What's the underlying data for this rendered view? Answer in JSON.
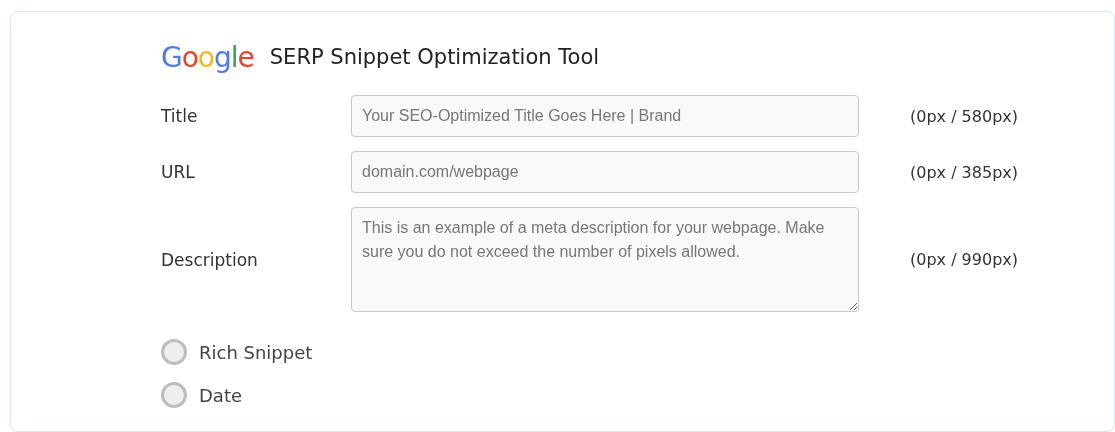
{
  "header": {
    "logo": "Google",
    "title": "SERP Snippet Optimization Tool"
  },
  "fields": [
    {
      "kind": "input",
      "label": "Title",
      "placeholder": "Your SEO-Optimized Title Goes Here | Brand",
      "counter": "(0px / 580px)"
    },
    {
      "kind": "input",
      "label": "URL",
      "placeholder": "domain.com/webpage",
      "counter": "(0px / 385px)"
    },
    {
      "kind": "textarea",
      "label": "Description",
      "placeholder": "This is an example of a meta description for your webpage. Make sure you do not exceed the number of pixels allowed.",
      "counter": "(0px / 990px)"
    }
  ],
  "options": [
    {
      "label": "Rich Snippet",
      "selected": false
    },
    {
      "label": "Date",
      "selected": false
    }
  ]
}
